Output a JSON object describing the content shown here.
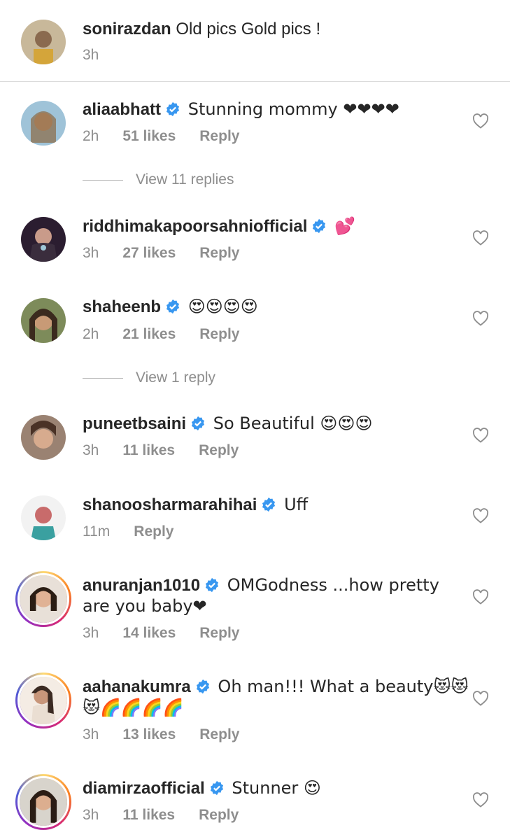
{
  "caption": {
    "username": "sonirazdan",
    "text": "Old pics Gold pics !",
    "time": "3h"
  },
  "comments": [
    {
      "username": "aliaabhatt",
      "verified": true,
      "text": "Stunning mommy ❤❤❤❤",
      "time": "2h",
      "likes": "51 likes",
      "reply": "Reply",
      "view_replies": "View 11 replies"
    },
    {
      "username": "riddhimakapoorsahniofficial",
      "verified": true,
      "text": "💕",
      "time": "3h",
      "likes": "27 likes",
      "reply": "Reply"
    },
    {
      "username": "shaheenb",
      "verified": true,
      "text": "😍😍😍😍",
      "time": "2h",
      "likes": "21 likes",
      "reply": "Reply",
      "view_replies": "View 1 reply"
    },
    {
      "username": "puneetbsaini",
      "verified": true,
      "text": "So Beautiful 😍😍😍",
      "time": "3h",
      "likes": "11 likes",
      "reply": "Reply"
    },
    {
      "username": "shanoosharmarahihai",
      "verified": true,
      "text": "Uff",
      "time": "11m",
      "reply": "Reply"
    },
    {
      "username": "anuranjan1010",
      "verified": true,
      "text": "OMGodness ...how pretty",
      "text2": "are you baby❤",
      "time": "3h",
      "likes": "14 likes",
      "reply": "Reply"
    },
    {
      "username": "aahanakumra",
      "verified": true,
      "text": "Oh man!!! What a beauty😻😻",
      "text2": "😻🌈🌈🌈🌈",
      "time": "3h",
      "likes": "13 likes",
      "reply": "Reply"
    },
    {
      "username": "diamirzaofficial",
      "verified": true,
      "text": "Stunner 😍",
      "time": "3h",
      "likes": "11 likes",
      "reply": "Reply"
    }
  ],
  "colors": {
    "verified": "#3897f0",
    "muted": "#8e8e8e",
    "text": "#262626"
  }
}
